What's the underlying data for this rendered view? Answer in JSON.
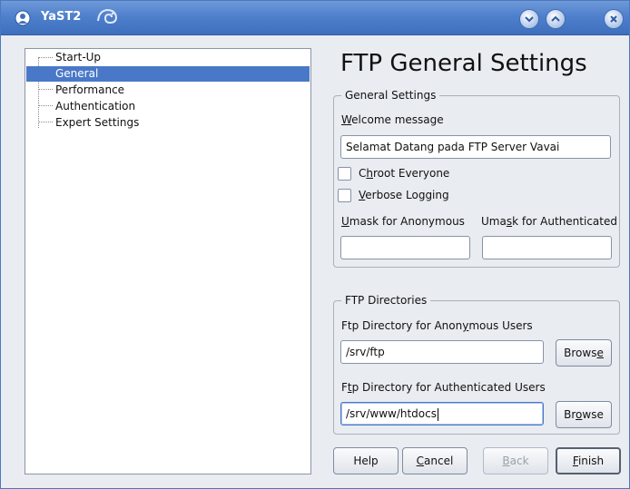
{
  "window": {
    "title": "YaST2",
    "icons": [
      "yast-app-icon",
      "chameleon-icon",
      "minimize-icon",
      "maximize-icon",
      "close-icon"
    ]
  },
  "tree": {
    "items": [
      {
        "label": "Start-Up",
        "selected": false
      },
      {
        "label": "General",
        "selected": true
      },
      {
        "label": "Performance",
        "selected": false
      },
      {
        "label": "Authentication",
        "selected": false
      },
      {
        "label": "Expert Settings",
        "selected": false
      }
    ]
  },
  "page": {
    "title": "FTP General Settings"
  },
  "general_settings": {
    "legend": "General Settings",
    "welcome_label_mnemonic": "W",
    "welcome_label_rest": "elcome message",
    "welcome_value": "Selamat Datang pada FTP Server Vavai",
    "chroot_pre": "C",
    "chroot_mnemonic": "h",
    "chroot_rest": "root Everyone",
    "chroot_checked": false,
    "verbose_mnemonic": "V",
    "verbose_rest": "erbose Logging",
    "verbose_checked": false,
    "umask_anon_mnemonic": "U",
    "umask_anon_rest": "mask for Anonymous",
    "umask_anon_value": "",
    "umask_auth_pre": "Uma",
    "umask_auth_mnemonic": "s",
    "umask_auth_rest": "k for Authenticated",
    "umask_auth_value": ""
  },
  "ftp_directories": {
    "legend": "FTP Directories",
    "anon_pre": "Ftp Directory for Anon",
    "anon_mnemonic": "y",
    "anon_rest": "mous Users",
    "anon_value": "/srv/ftp",
    "browse1_pre": "Brows",
    "browse1_mnemonic": "e",
    "auth_pre": "F",
    "auth_mnemonic": "t",
    "auth_rest": "p Directory for Authenticated Users",
    "auth_value": "/srv/www/htdocs",
    "browse2_pre": "Br",
    "browse2_mnemonic": "o",
    "browse2_rest": "wse"
  },
  "buttons": {
    "help": "Help",
    "cancel_mnemonic": "C",
    "cancel_rest": "ancel",
    "back_mnemonic": "B",
    "back_rest": "ack",
    "back_enabled": false,
    "finish_mnemonic": "F",
    "finish_rest": "inish"
  },
  "colors": {
    "titlebar": "#4f80cc",
    "selection": "#4a78c8",
    "window_bg": "#e9ecf1"
  }
}
